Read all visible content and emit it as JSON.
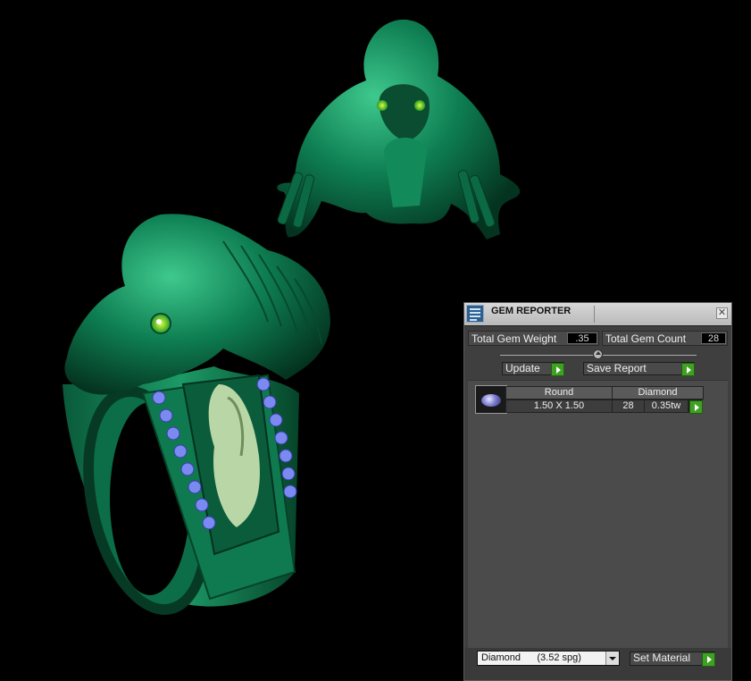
{
  "panel": {
    "title": "GEM REPORTER",
    "close_glyph": "✕",
    "total_weight_label": "Total Gem Weight",
    "total_weight_value": ".35",
    "total_count_label": "Total Gem Count",
    "total_count_value": "28",
    "update_label": "Update",
    "save_report_label": "Save Report",
    "table": {
      "header": [
        "Round",
        "Diamond"
      ],
      "row": {
        "size": "1.50 X 1.50",
        "count": "28",
        "weight": "0.35tw"
      }
    },
    "material_select_value": "Diamond      (3.52 spg)",
    "set_material_label": "Set Material"
  },
  "icons": {
    "app": "gem-reporter-icon",
    "close": "close-icon",
    "go": "play-arrow-icon",
    "gem": "round-gem-icon",
    "dropdown": "chevron-down-icon"
  },
  "colors": {
    "background": "#000000",
    "model_green": "#0e7e52",
    "panel_bg": "#3f3f3f",
    "go_button": "#3fa023",
    "gem_blue": "#7f7fd0",
    "relief": "#b9d7a6"
  }
}
